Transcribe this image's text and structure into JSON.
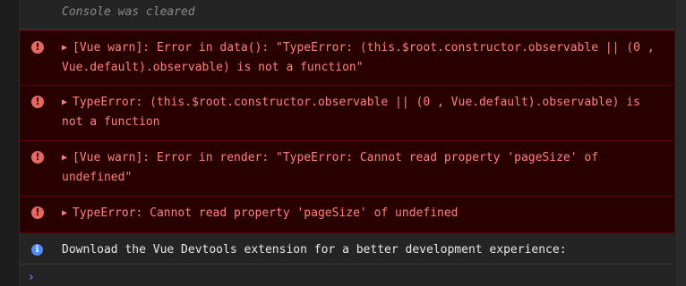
{
  "console": {
    "cleared_text": "Console was cleared",
    "messages": [
      {
        "level": "error",
        "icon": "error-icon",
        "text": "[Vue warn]: Error in data(): \"TypeError: (this.$root.constructor.observable || (0 , Vue.default).observable) is not a function\""
      },
      {
        "level": "error",
        "icon": "error-icon",
        "text": "TypeError: (this.$root.constructor.observable || (0 , Vue.default).observable) is not a function"
      },
      {
        "level": "error",
        "icon": "error-icon",
        "text": "[Vue warn]: Error in render: \"TypeError: Cannot read property 'pageSize' of undefined\""
      },
      {
        "level": "error",
        "icon": "error-icon",
        "text": "TypeError: Cannot read property 'pageSize' of undefined"
      },
      {
        "level": "info",
        "icon": "info-icon",
        "text": "Download the Vue Devtools extension for a better development experience:"
      }
    ],
    "prompt": {
      "icon": "prompt-chevron-icon",
      "glyph": "›",
      "value": ""
    }
  },
  "colors": {
    "background": "#242424",
    "error_background": "#290000",
    "error_text": "#ff8080",
    "error_border": "#5c0000",
    "info_accent": "#4f8cff"
  }
}
